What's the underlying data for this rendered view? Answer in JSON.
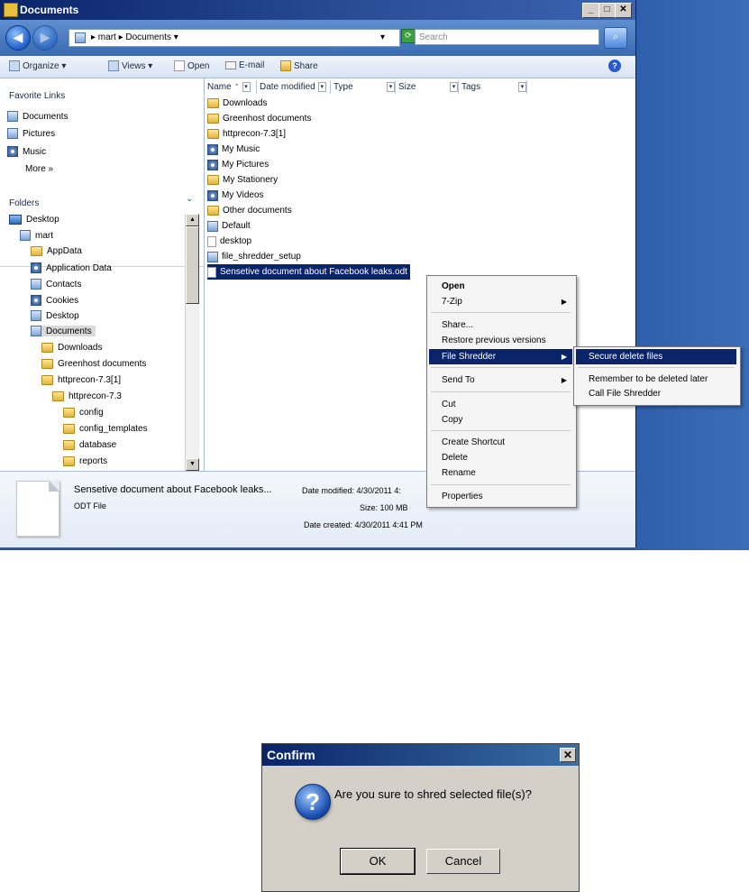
{
  "window": {
    "title": "Documents",
    "min_glyph": "_",
    "max_glyph": "□",
    "close_glyph": "✕"
  },
  "address": {
    "crumbs": "▸ mart ▸ Documents ▾",
    "dropdown_glyph": "▾",
    "search_placeholder": "Search"
  },
  "commands": {
    "organize": "Organize ▾",
    "views": "Views ▾",
    "open": "Open",
    "email": "E-mail",
    "share": "Share"
  },
  "nav": {
    "favorite_heading": "Favorite Links",
    "favorites": [
      "Documents",
      "Pictures",
      "Music"
    ],
    "more": "More »",
    "folders_heading": "Folders",
    "tree": [
      "Desktop",
      "mart",
      "AppData",
      "Application Data",
      "Contacts",
      "Cookies",
      "Desktop",
      "Documents",
      "Downloads",
      "Greenhost documents",
      "httprecon-7.3[1]",
      "httprecon-7.3",
      "config",
      "config_templates",
      "database",
      "reports"
    ]
  },
  "columns": [
    "Name",
    "Date modified",
    "Type",
    "Size",
    "Tags"
  ],
  "files": [
    "Downloads",
    "Greenhost documents",
    "httprecon-7.3[1]",
    "My Music",
    "My Pictures",
    "My Stationery",
    "My Videos",
    "Other documents",
    "Default",
    "desktop",
    "file_shredder_setup",
    "Sensetive document about Facebook leaks.odt"
  ],
  "details": {
    "name": "Sensetive document about Facebook leaks...",
    "type": "ODT File",
    "date_modified": "Date modified: 4/30/2011 4:",
    "size": "Size: 100 MB",
    "date_created": "Date created: 4/30/2011 4:41 PM"
  },
  "context_menu": {
    "items": [
      "Open",
      "7-Zip",
      "Share...",
      "Restore previous versions",
      "File Shredder",
      "Send To",
      "Cut",
      "Copy",
      "Create Shortcut",
      "Delete",
      "Rename",
      "Properties"
    ],
    "submenu": [
      "Secure delete files",
      "Remember to be deleted later",
      "Call File Shredder"
    ]
  },
  "dialog": {
    "title": "Confirm",
    "close_glyph": "✕",
    "icon_glyph": "?",
    "message": "Are you sure to shred selected file(s)?",
    "ok": "OK",
    "cancel": "Cancel"
  },
  "colors": {
    "titlebar": "#0a246a",
    "selection": "#0a246a",
    "desktop": "#2a55a0",
    "dialog_face": "#d4d0c8"
  }
}
